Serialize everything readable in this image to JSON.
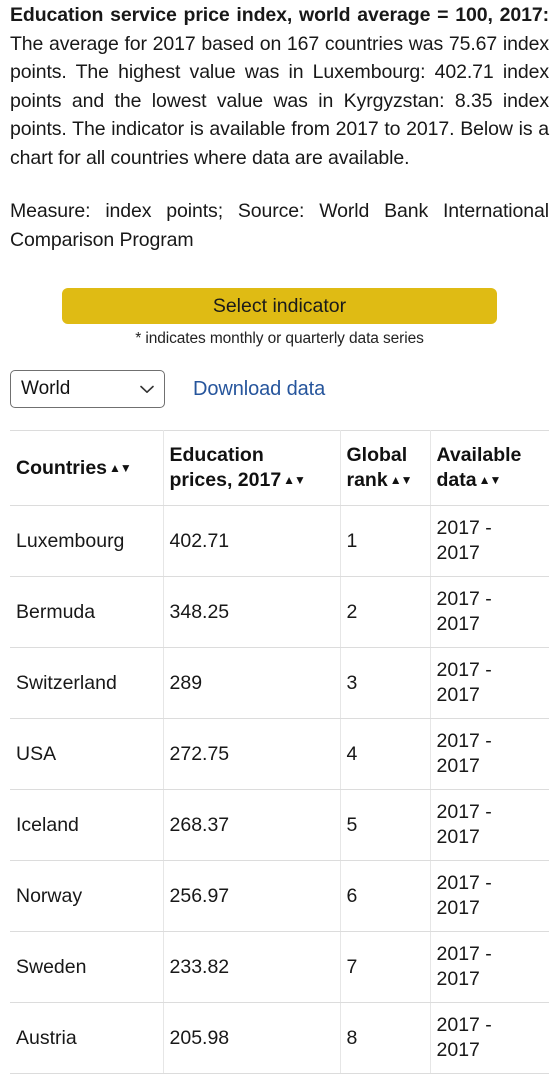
{
  "intro": {
    "lead": "Education service price index, world average = 100, 2017:",
    "body": " The average for 2017 based on 167 countries was 75.67 index points. The highest value was in Luxembourg: 402.71 index points and the lowest value was in Kyrgyzstan: 8.35 index points. The indicator is available from 2017 to 2017. Below is a chart for all countries where data are available."
  },
  "meta_line": "Measure: index points; Source: World Bank International Comparison Program",
  "button": {
    "select_indicator_label": "Select indicator",
    "color": "#dfbb14"
  },
  "footnote": "* indicates monthly or quarterly data series",
  "controls": {
    "region_selected": "World",
    "region_options": [
      "World"
    ],
    "download_label": "Download data",
    "link_color": "#26559c",
    "chevron_icon": "chevron-down-icon"
  },
  "table": {
    "sort_glyph": "▲▼",
    "headers": [
      "Countries",
      "Education prices, 2017",
      "Global rank",
      "Available data"
    ],
    "rows": [
      {
        "country": "Luxembourg",
        "value": "402.71",
        "rank": "1",
        "available": "2017 -\n2017"
      },
      {
        "country": "Bermuda",
        "value": "348.25",
        "rank": "2",
        "available": "2017 -\n2017"
      },
      {
        "country": "Switzerland",
        "value": "289",
        "rank": "3",
        "available": "2017 -\n2017"
      },
      {
        "country": "USA",
        "value": "272.75",
        "rank": "4",
        "available": "2017 -\n2017"
      },
      {
        "country": "Iceland",
        "value": "268.37",
        "rank": "5",
        "available": "2017 -\n2017"
      },
      {
        "country": "Norway",
        "value": "256.97",
        "rank": "6",
        "available": "2017 -\n2017"
      },
      {
        "country": "Sweden",
        "value": "233.82",
        "rank": "7",
        "available": "2017 -\n2017"
      },
      {
        "country": "Austria",
        "value": "205.98",
        "rank": "8",
        "available": "2017 -\n2017"
      }
    ]
  }
}
